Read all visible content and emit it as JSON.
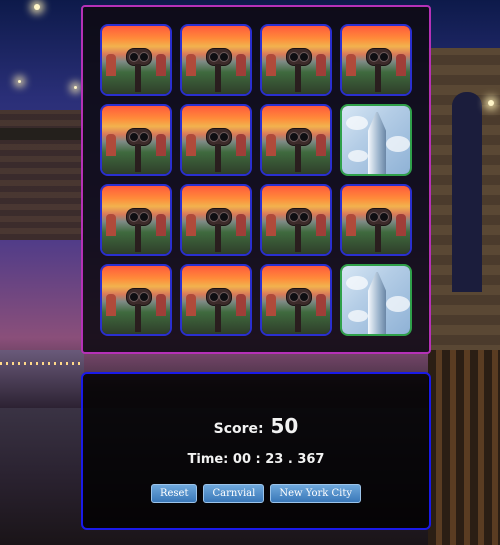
{
  "game": {
    "score_label": "Score:",
    "score_value": "50",
    "time_label": "Time:",
    "time_value": "00 : 23 . 367"
  },
  "buttons": {
    "reset": "Reset",
    "carnival": "Carnvial",
    "nyc": "New York City"
  },
  "cards": [
    {
      "state": "hidden",
      "image": "binoculars-viewpoint"
    },
    {
      "state": "hidden",
      "image": "binoculars-viewpoint"
    },
    {
      "state": "hidden",
      "image": "binoculars-viewpoint"
    },
    {
      "state": "hidden",
      "image": "binoculars-viewpoint"
    },
    {
      "state": "hidden",
      "image": "binoculars-viewpoint"
    },
    {
      "state": "hidden",
      "image": "binoculars-viewpoint"
    },
    {
      "state": "hidden",
      "image": "binoculars-viewpoint"
    },
    {
      "state": "matched",
      "image": "one-world-trade-center"
    },
    {
      "state": "hidden",
      "image": "binoculars-viewpoint"
    },
    {
      "state": "hidden",
      "image": "binoculars-viewpoint"
    },
    {
      "state": "hidden",
      "image": "binoculars-viewpoint"
    },
    {
      "state": "hidden",
      "image": "binoculars-viewpoint"
    },
    {
      "state": "hidden",
      "image": "binoculars-viewpoint"
    },
    {
      "state": "hidden",
      "image": "binoculars-viewpoint"
    },
    {
      "state": "hidden",
      "image": "binoculars-viewpoint"
    },
    {
      "state": "matched",
      "image": "one-world-trade-center"
    }
  ],
  "colors": {
    "board_border": "#b531b7",
    "panel_border": "#1a1ae8",
    "card_border": "#2a2fd0",
    "matched_border": "#2fa04a",
    "button": "#4a88c8"
  }
}
